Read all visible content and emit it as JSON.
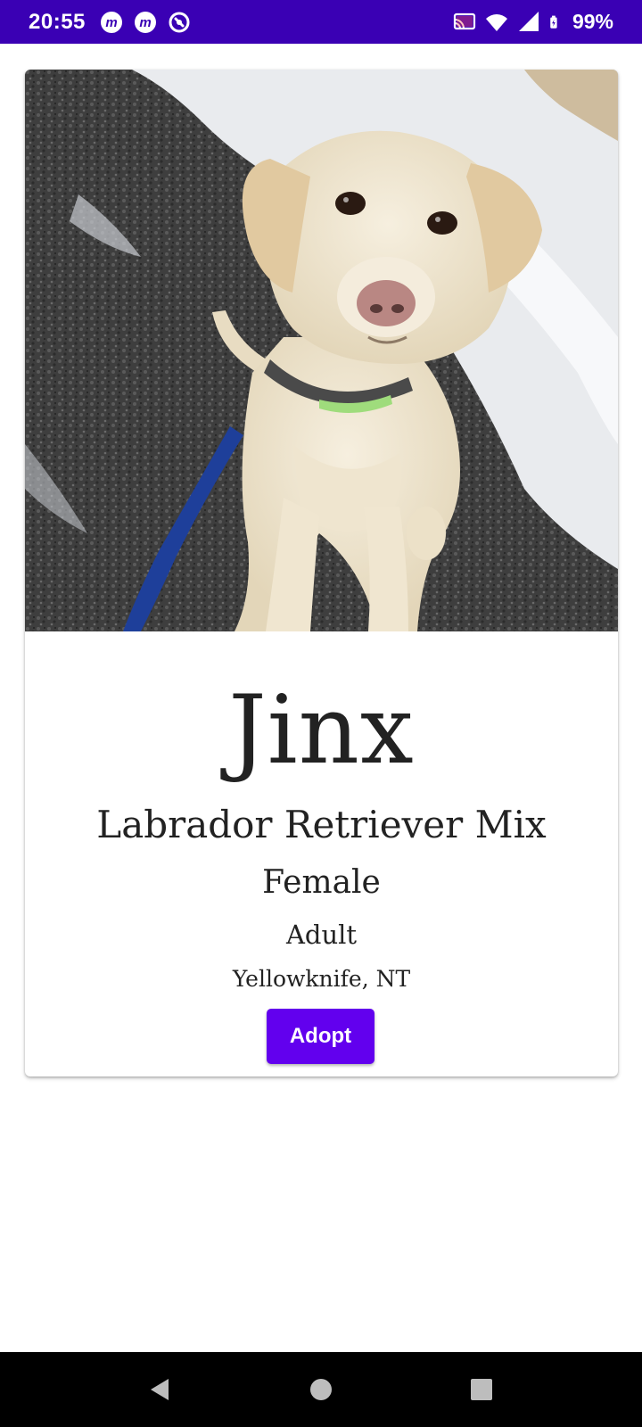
{
  "status_bar": {
    "time": "20:55",
    "battery": "99%",
    "background": "#3a00b4",
    "notification_icons": [
      "meetup-icon",
      "meetup-icon",
      "sync-icon"
    ],
    "system_icons": [
      "cast-icon",
      "wifi-icon",
      "signal-icon",
      "battery-charging-icon"
    ]
  },
  "pet": {
    "photo_alt": "Jinx",
    "name": "Jinx",
    "breed": "Labrador Retriever Mix",
    "sex": "Female",
    "age": "Adult",
    "location": "Yellowknife, NT"
  },
  "actions": {
    "adopt_label": "Adopt",
    "accent": "#6200ee"
  },
  "nav_bar": {
    "buttons": [
      "back-icon",
      "home-icon",
      "recents-icon"
    ]
  }
}
